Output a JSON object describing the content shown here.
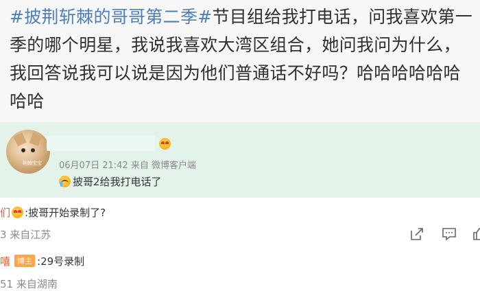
{
  "post": {
    "hashtag": "#披荆斩棘的哥哥第二季#",
    "body": "节目组给我打电话，问我喜欢第一季的哪个明星，我说我喜欢大湾区组合，她问我问为什么，我回答说我可以说是因为他们普通话不好吗？哈哈哈哈哈哈哈哈"
  },
  "pinned_comment": {
    "avatar_watermark": "荆棘宝宝",
    "meta": "06月07日 21:42  来自 微博客户端",
    "text": "披哥2给我打电话了",
    "name_icon": "heart-eyes-emoji",
    "text_icon": "crying-emoji"
  },
  "replies": [
    {
      "name": "们",
      "text": ":披哥开始录制了?",
      "meta": "3 来自江苏",
      "icon": "heart-eyes-emoji"
    },
    {
      "name": "嘻",
      "badge": "博主",
      "text": ":29号录制",
      "meta": "51 来自湖南"
    }
  ],
  "icons": {
    "share": "share-icon",
    "comment": "comment-icon",
    "like": "like-icon"
  },
  "colors": {
    "hashtag": "#4d7fb8",
    "pinned_bg": "#e4f3ea",
    "post_bg": "#f7f7f7",
    "badge": "#fda54a",
    "reply_name": "#e85a2f"
  }
}
